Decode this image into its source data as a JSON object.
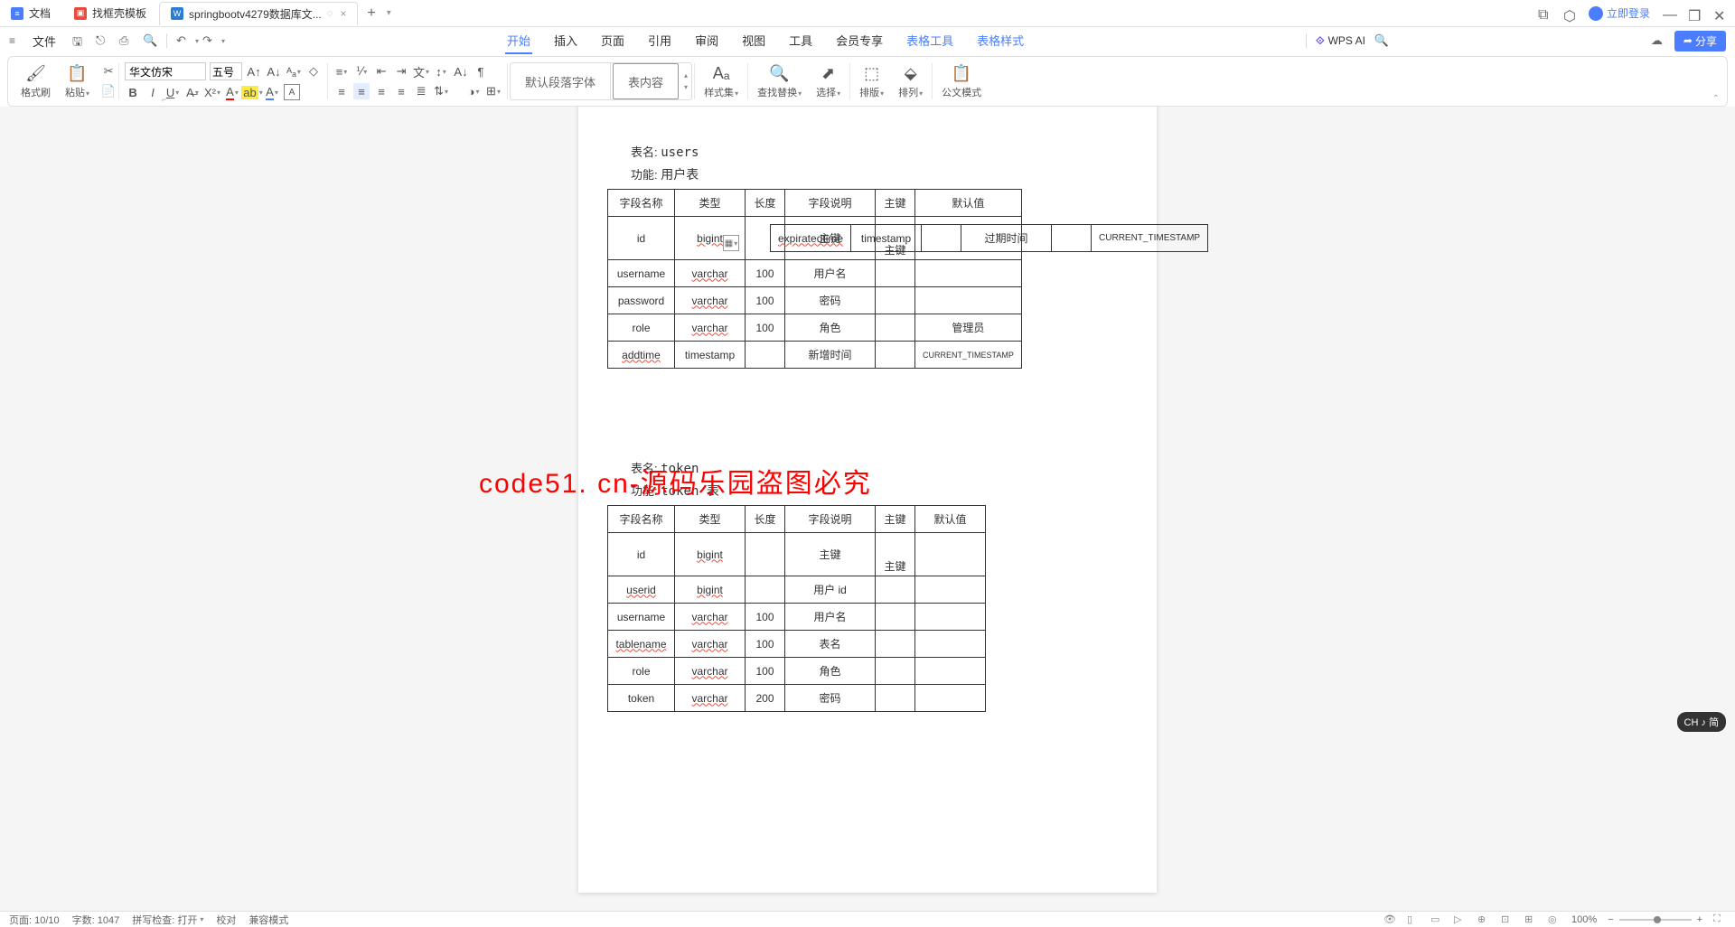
{
  "tabs": [
    {
      "icon": "blue",
      "label": "文档"
    },
    {
      "icon": "red",
      "label": "找框壳模板"
    },
    {
      "icon": "word",
      "label": "springbootv4279数据库文..."
    }
  ],
  "login": "立即登录",
  "file_menu": "文件",
  "menu": {
    "start": "开始",
    "insert": "插入",
    "page": "页面",
    "ref": "引用",
    "review": "审阅",
    "view": "视图",
    "tool": "工具",
    "member": "会员专享",
    "table_tool": "表格工具",
    "table_style": "表格样式"
  },
  "wps_ai": "WPS AI",
  "share": "分享",
  "ribbon": {
    "format_brush": "格式刷",
    "paste": "粘贴",
    "font_name": "华文仿宋",
    "font_size": "五号",
    "style_default": "默认段落字体",
    "style_content": "表内容",
    "style_set": "样式集",
    "find_replace": "查找替换",
    "select": "选择",
    "sort": "排版",
    "arrange": "排列",
    "official": "公文模式"
  },
  "doc": {
    "table1": {
      "name_label": "表名:",
      "name": "users",
      "func_label": "功能:",
      "func": "用户表",
      "headers": [
        "字段名称",
        "类型",
        "长度",
        "字段说明",
        "主键",
        "默认值"
      ],
      "rows": [
        {
          "f": "id",
          "t": "bigint",
          "l": "",
          "d": "主键",
          "p": "主键",
          "v": ""
        },
        {
          "f": "username",
          "t": "varchar",
          "l": "100",
          "d": "用户名",
          "p": "",
          "v": ""
        },
        {
          "f": "password",
          "t": "varchar",
          "l": "100",
          "d": "密码",
          "p": "",
          "v": ""
        },
        {
          "f": "role",
          "t": "varchar",
          "l": "100",
          "d": "角色",
          "p": "",
          "v": "管理员"
        },
        {
          "f": "addtime",
          "t": "timestamp",
          "l": "",
          "d": "新增时间",
          "p": "",
          "v": "CURRENT_TIMESTAMP"
        }
      ]
    },
    "table2": {
      "name_label": "表名:",
      "name": "token",
      "func_label": "功能:",
      "func": "token 表",
      "headers": [
        "字段名称",
        "类型",
        "长度",
        "字段说明",
        "主键",
        "默认值"
      ],
      "rows": [
        {
          "f": "id",
          "t": "bigint",
          "l": "",
          "d": "主键",
          "p": "主键",
          "v": ""
        },
        {
          "f": "userid",
          "t": "bigint",
          "l": "",
          "d": "用户 id",
          "p": "",
          "v": ""
        },
        {
          "f": "username",
          "t": "varchar",
          "l": "100",
          "d": "用户名",
          "p": "",
          "v": ""
        },
        {
          "f": "tablename",
          "t": "varchar",
          "l": "100",
          "d": "表名",
          "p": "",
          "v": ""
        },
        {
          "f": "role",
          "t": "varchar",
          "l": "100",
          "d": "角色",
          "p": "",
          "v": ""
        },
        {
          "f": "token",
          "t": "varchar",
          "l": "200",
          "d": "密码",
          "p": "",
          "v": ""
        }
      ]
    },
    "right_row": {
      "f": "expiratedtime",
      "t": "timestamp",
      "l": "",
      "d": "过期时间",
      "p": "",
      "v": "CURRENT_TIMESTAMP"
    }
  },
  "watermark": "code51. cn-源码乐园盗图必究",
  "status": {
    "page": "页面: 10/10",
    "words": "字数: 1047",
    "spell": "拼写检查: 打开",
    "proof": "校对",
    "compat": "兼容模式",
    "zoom": "100%"
  },
  "ime": "CH ♪ 简"
}
